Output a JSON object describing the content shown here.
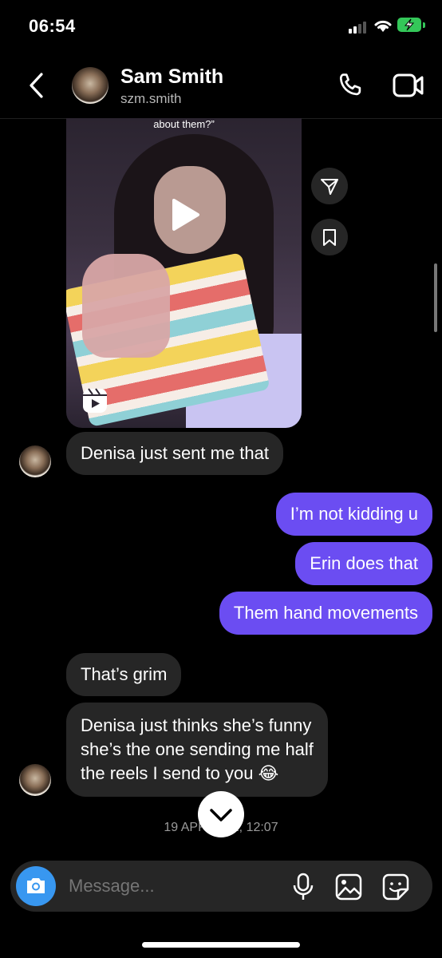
{
  "status_bar": {
    "time": "06:54"
  },
  "header": {
    "name": "Sam Smith",
    "handle": "szm.smith"
  },
  "reel": {
    "caption": "about them?”"
  },
  "messages": [
    {
      "side": "in",
      "text": "Denisa just sent me that"
    },
    {
      "side": "out",
      "text": "I’m not kidding u"
    },
    {
      "side": "out",
      "text": "Erin does that"
    },
    {
      "side": "out",
      "text": "Them hand movements"
    },
    {
      "side": "in",
      "text": "That’s grim"
    },
    {
      "side": "in",
      "lines": [
        "Denisa just thinks she’s funny",
        "she’s the one sending me half",
        "the reels I send to you 😂"
      ]
    }
  ],
  "timestamp": "19 APR 2022, 12:07",
  "composer": {
    "placeholder": "Message..."
  },
  "colors": {
    "outgoing_bubble": "#6b4df2",
    "incoming_bubble": "#262626",
    "camera_button": "#3897f0",
    "battery": "#34c759"
  },
  "icons": [
    "back-icon",
    "phone-icon",
    "video-camera-icon",
    "play-icon",
    "reels-icon",
    "share-icon",
    "bookmark-icon",
    "chevron-down-icon",
    "camera-icon",
    "microphone-icon",
    "image-icon",
    "sticker-icon"
  ]
}
